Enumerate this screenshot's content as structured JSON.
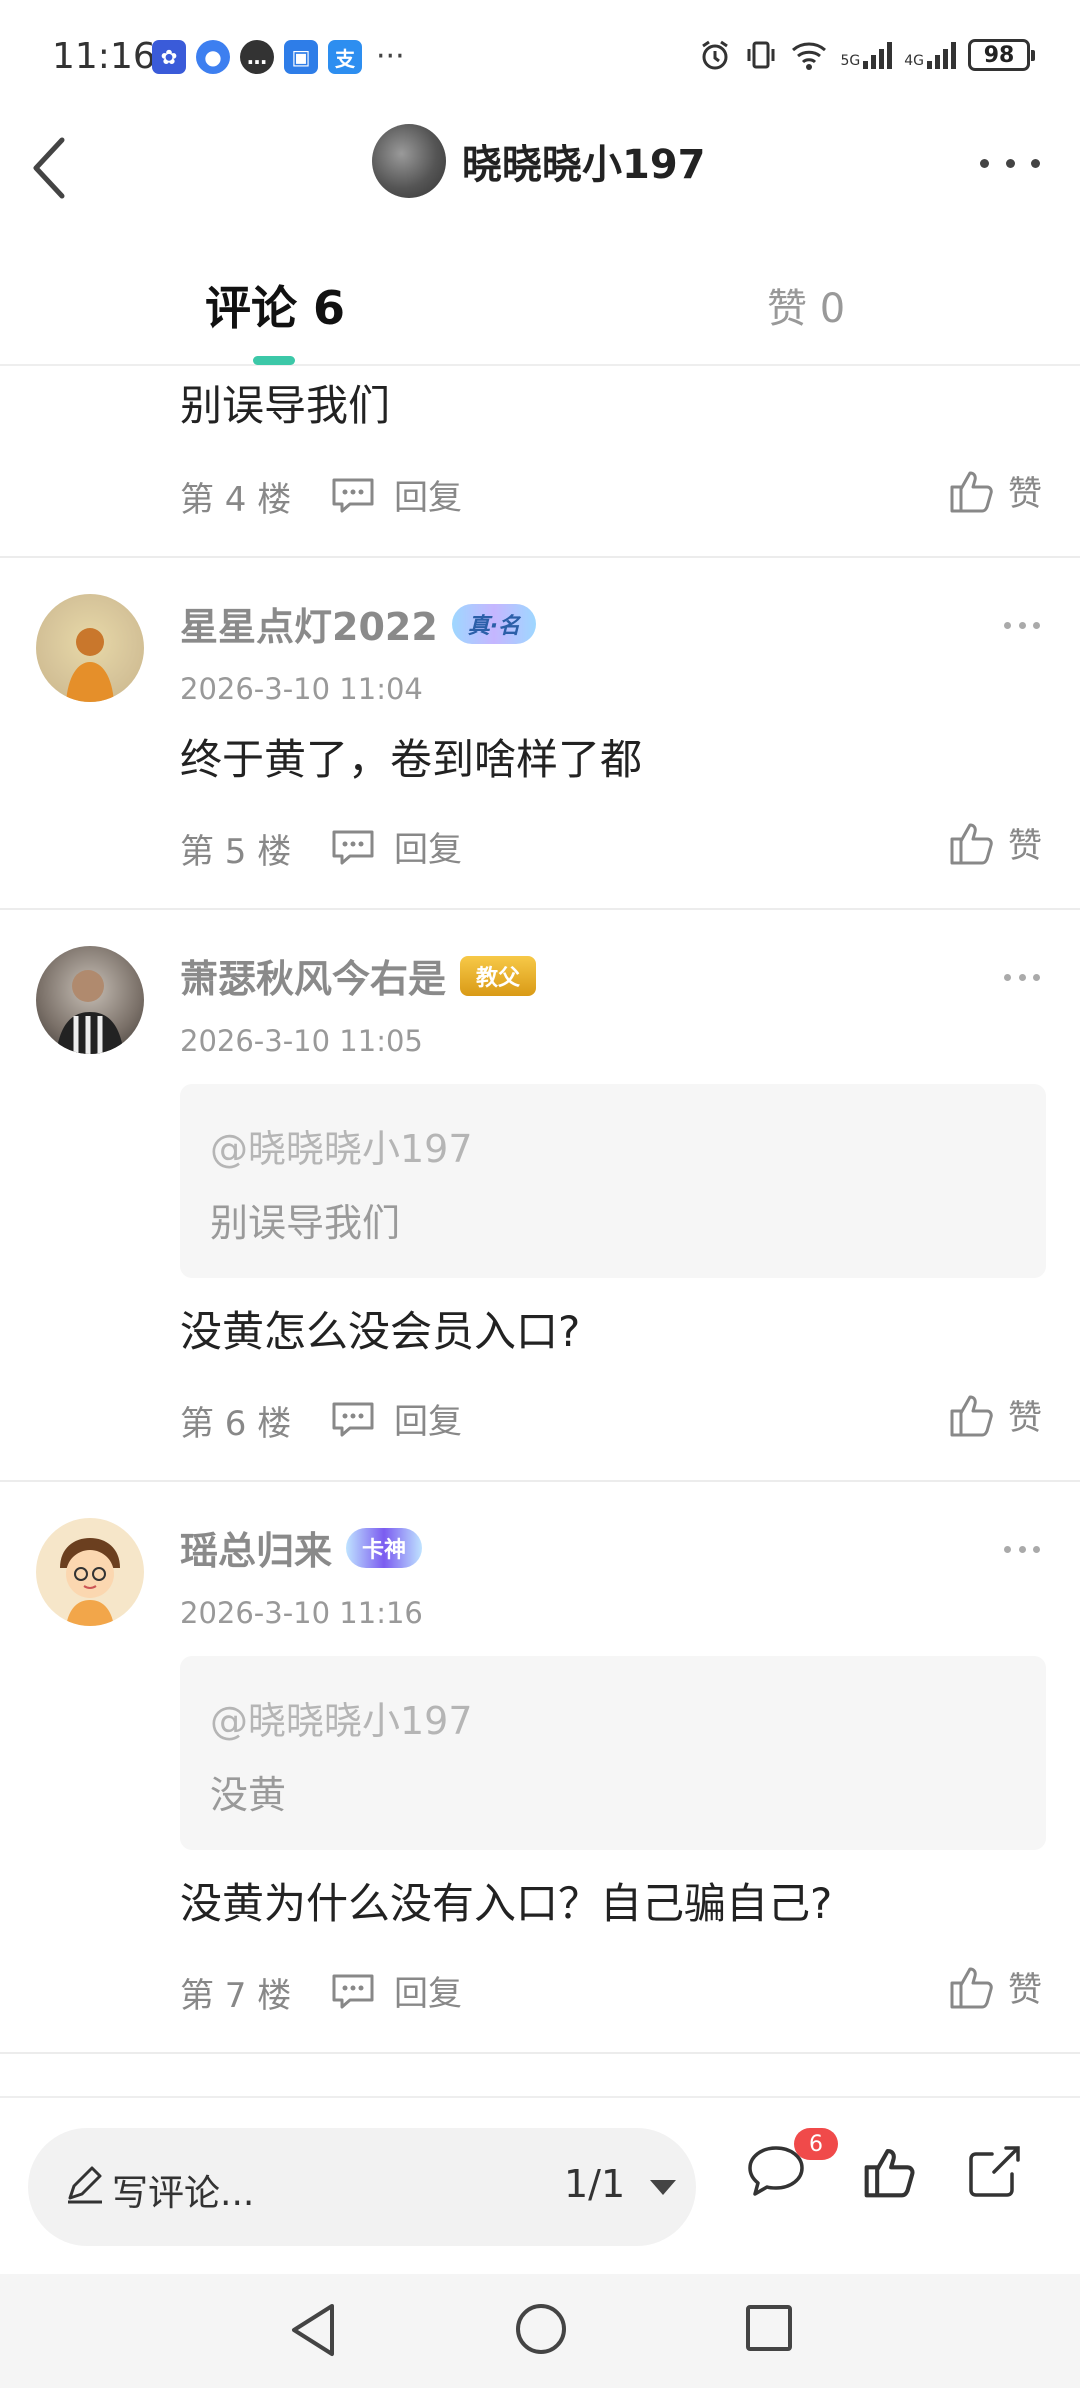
{
  "status_bar": {
    "time": "11:16",
    "more": "···",
    "network_1": "5G",
    "network_2": "4G",
    "battery": "98"
  },
  "header": {
    "title": "晓晓晓小197"
  },
  "tabs": {
    "comments": "评论 6",
    "likes": "赞 0"
  },
  "comments": [
    {
      "content": "别误导我们",
      "floor": "第 4 楼",
      "reply": "回复",
      "like": "赞"
    },
    {
      "username": "星星点灯2022",
      "badge": "真·名",
      "time": "2026-3-10 11:04",
      "content": "终于黄了，卷到啥样了都",
      "floor": "第 5 楼",
      "reply": "回复",
      "like": "赞"
    },
    {
      "username": "萧瑟秋风今右是",
      "badge": "教父",
      "time": "2026-3-10 11:05",
      "quote_at": "@晓晓晓小197",
      "quote_text": "别误导我们",
      "content": "没黄怎么没会员入口?",
      "floor": "第 6 楼",
      "reply": "回复",
      "like": "赞"
    },
    {
      "username": "瑶总归来",
      "badge": "卡神",
      "time": "2026-3-10 11:16",
      "quote_at": "@晓晓晓小197",
      "quote_text": "没黄",
      "content": "没黄为什么没有入口？自己骗自己?",
      "floor": "第 7 楼",
      "reply": "回复",
      "like": "赞"
    }
  ],
  "bottom_bar": {
    "write_placeholder": "写评论...",
    "page": "1/1",
    "comment_count": "6"
  },
  "colors": {
    "accent": "#3cc8a8",
    "badge_red": "#f04a4a"
  }
}
